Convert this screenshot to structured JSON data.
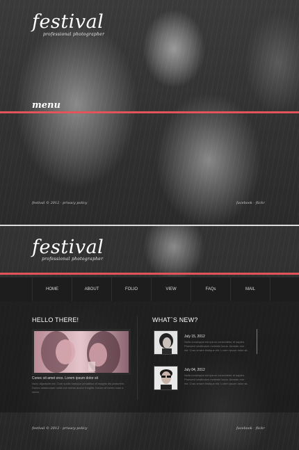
{
  "screen1": {
    "logo": "festival",
    "tagline": "professional photographer",
    "menu_label": "menu",
    "footer_left": "festival © 2012 · privacy policy",
    "footer_right": "facebook · flickr"
  },
  "screen2": {
    "logo": "festival",
    "tagline": "professional photographer",
    "nav": [
      "HOME",
      "ABOUT",
      "FOLIO",
      "VIEW",
      "FAQs",
      "MAIL"
    ],
    "hello": {
      "title": "HELLO THERE!",
      "lead": "Conec sit amet eros. Lorem ipsum dolor sit",
      "body": "Nunc dignissim est. Cum sociis natoque penatibus et magnis dis parturient. Donec ullamcorper nulla non metus auctor fringilla. Donec et lorem nunc a lorem."
    },
    "news": {
      "title": "WHAT`S NEW?",
      "items": [
        {
          "date": "July 15, 2012",
          "text": "Nulla consequat est ipsum consectetur et sapien. Praesent vestibulum molestie lacus. Aenean non est. Cras ornare tristique elit. Lorem ipsum dolor sit."
        },
        {
          "date": "July 04, 2012",
          "text": "Nulla consequat est ipsum consectetur et sapien. Praesent vestibulum molestie lacus. Aenean non est. Cras ornare tristique elit. Lorem ipsum dolor sit."
        }
      ]
    },
    "footer_left": "festival © 2012 · privacy policy",
    "footer_right": "facebook · flickr"
  },
  "colors": {
    "accent": "#e0545a",
    "background": "#1c1c1c"
  }
}
